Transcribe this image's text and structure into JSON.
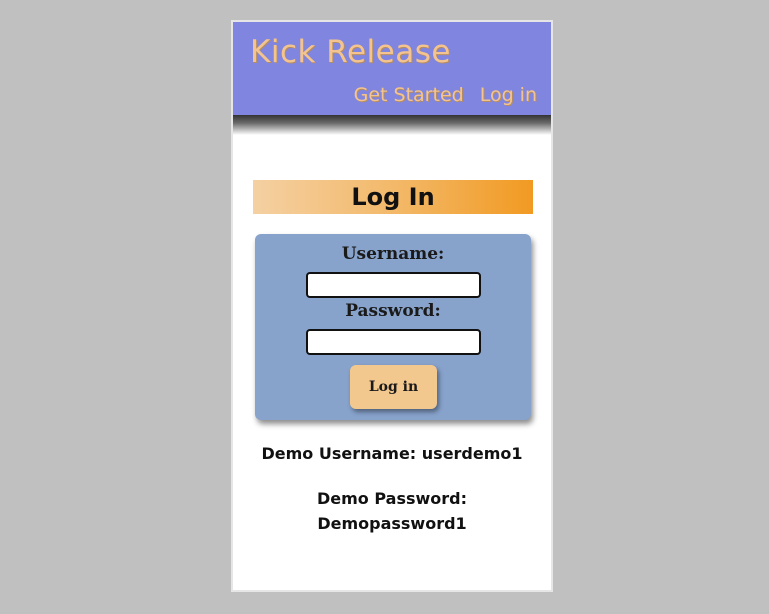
{
  "header": {
    "brand": "Kick Release",
    "nav": [
      "Get Started",
      "Log in"
    ]
  },
  "login": {
    "heading": "Log In",
    "username_label": "Username:",
    "username_value": "",
    "password_label": "Password:",
    "password_value": "",
    "submit_label": "Log in"
  },
  "demo": {
    "username_text": "Demo Username: userdemo1",
    "password_label": "Demo Password:",
    "password_value": "Demopassword1"
  },
  "colors": {
    "page_background": "#c0c0c0",
    "header": "#8085e0",
    "brand_text": "#f3c48f",
    "card": "#87a2cb",
    "button": "#f3c88f",
    "title_gradient_start": "#f4d0a2",
    "title_gradient_end": "#f19a22"
  }
}
